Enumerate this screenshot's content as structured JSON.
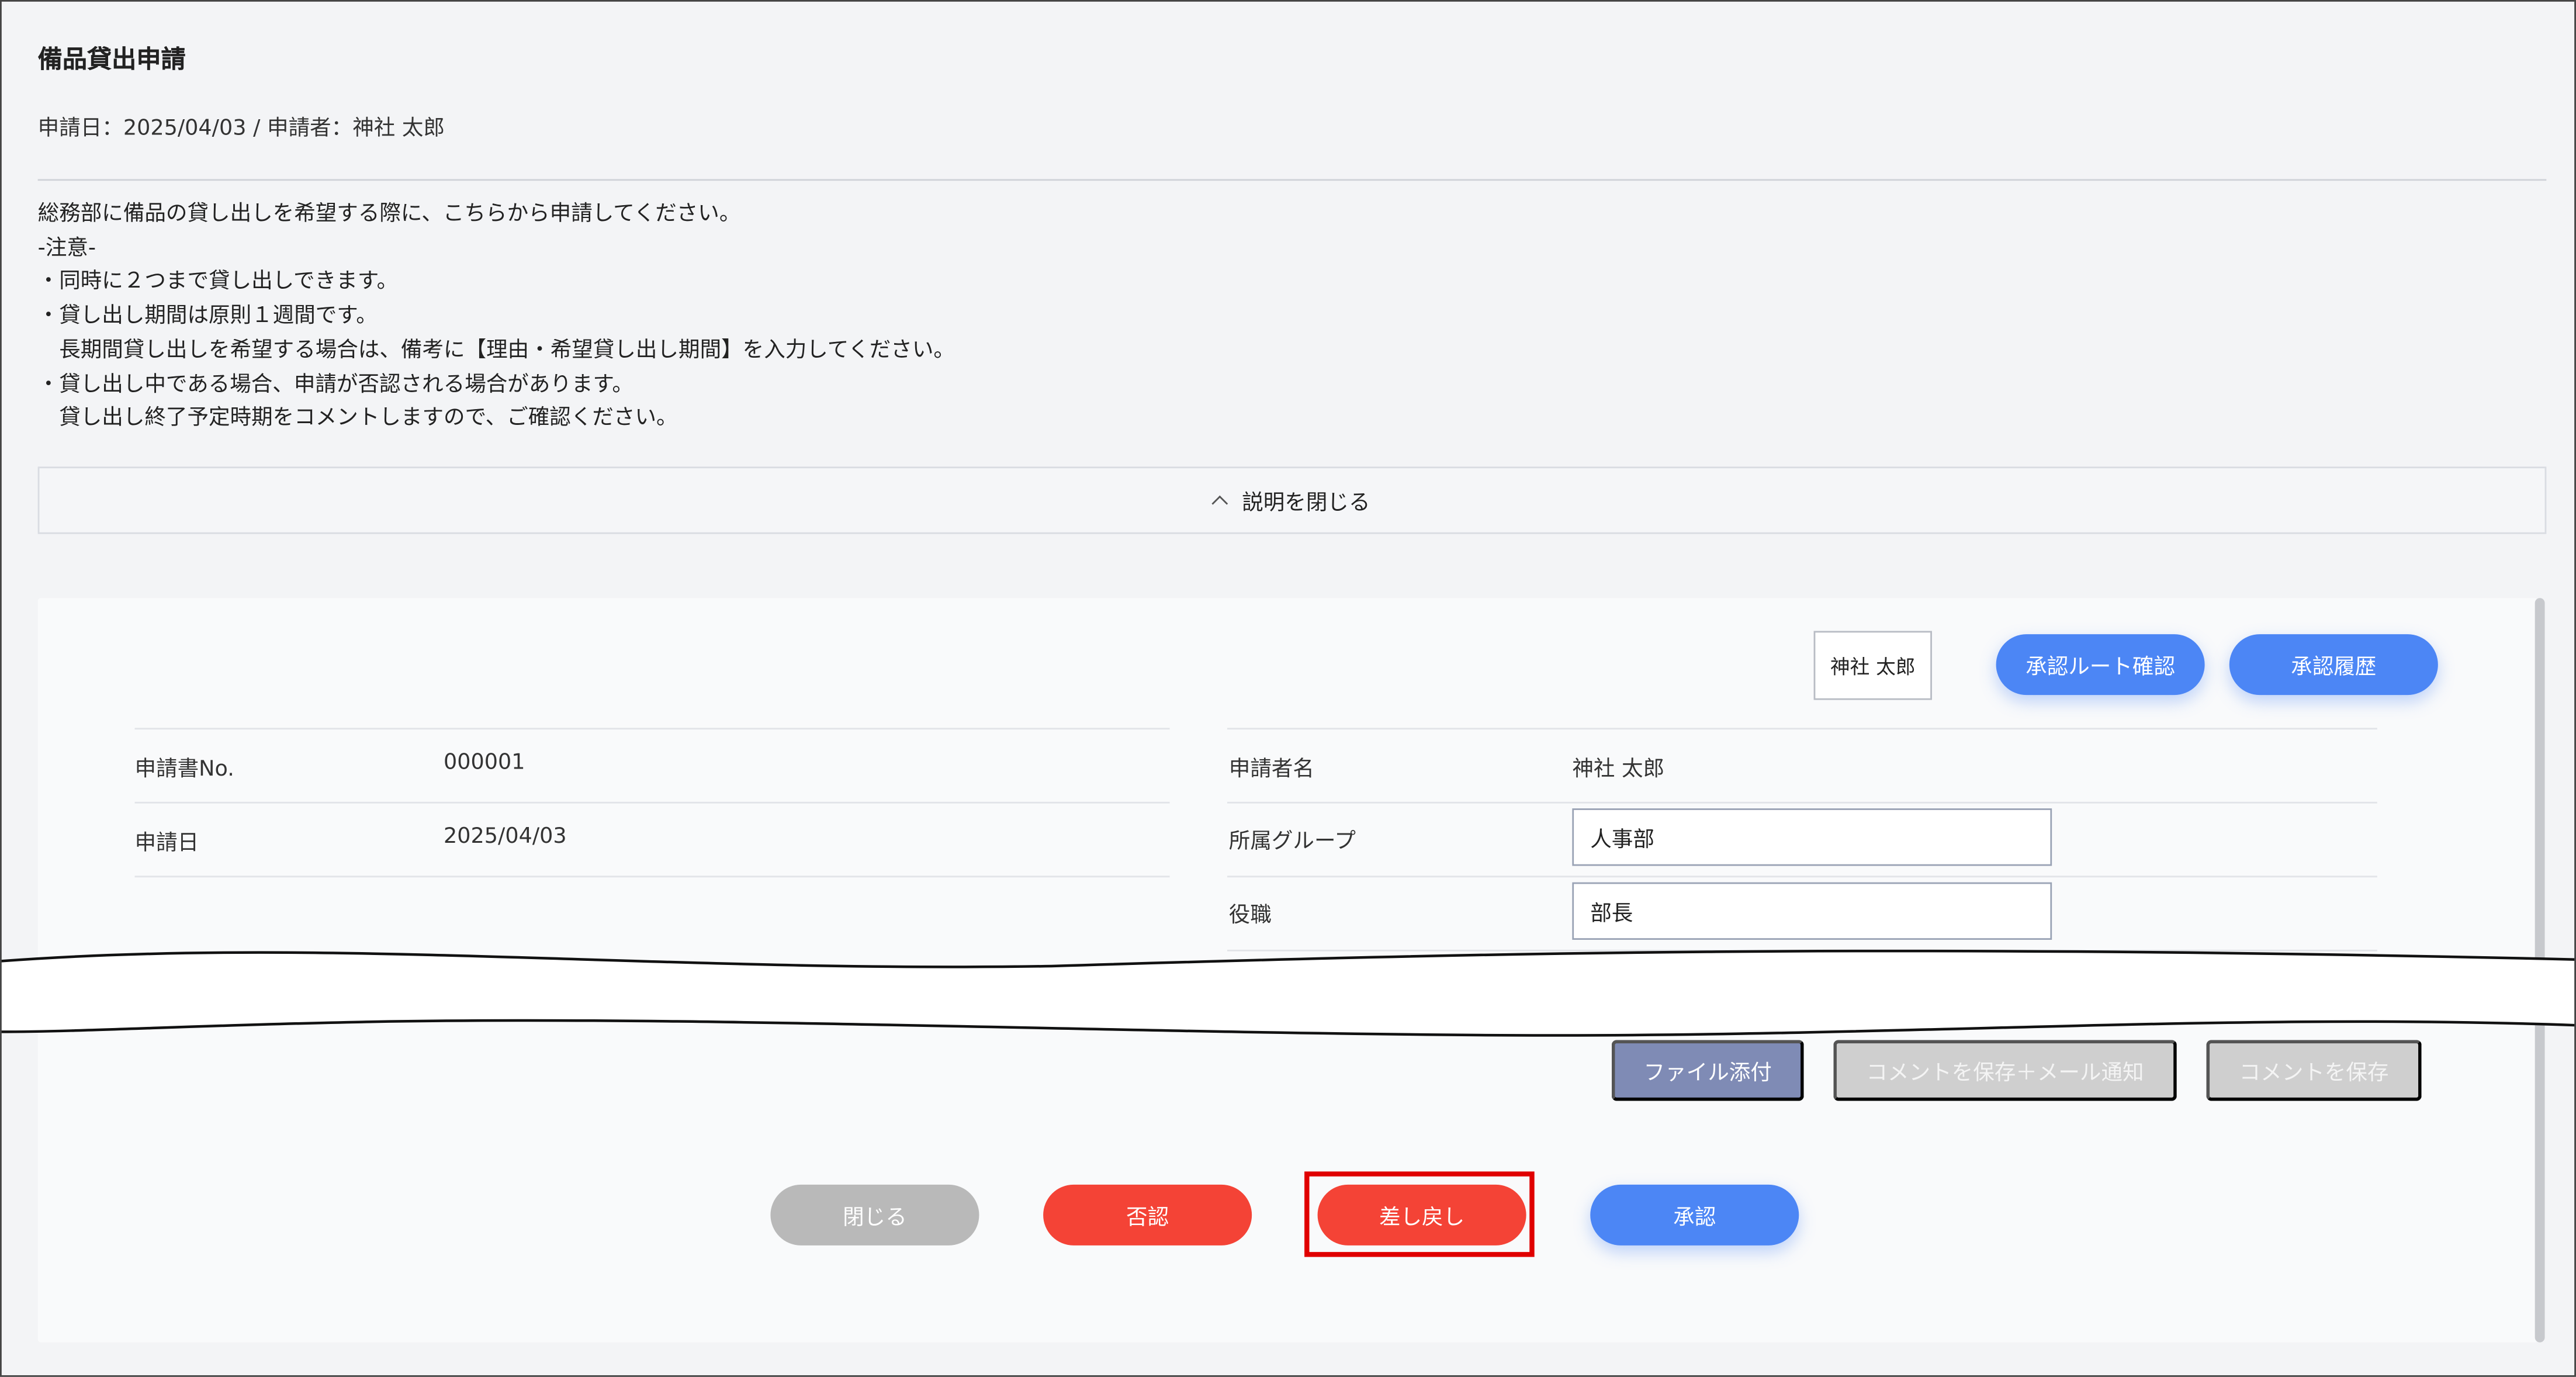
{
  "page": {
    "title": "備品貸出申請",
    "meta": "申請日：2025/04/03 / 申請者：神社 太郎"
  },
  "description": {
    "lines": [
      "総務部に備品の貸し出しを希望する際に、こちらから申請してください。",
      "-注意-",
      "・同時に２つまで貸し出しできます。",
      "・貸し出し期間は原則１週間です。",
      "　長期間貸し出しを希望する場合は、備考に【理由・希望貸し出し期間】を入力してください。",
      "・貸し出し中である場合、申請が否認される場合があります。",
      "　貸し出し終了予定時期をコメントしますので、ご確認ください。"
    ],
    "toggle_label": "説明を閉じる"
  },
  "header_actions": {
    "user_name": "神社 太郎",
    "route_button": "承認ルート確認",
    "history_button": "承認履歴"
  },
  "form": {
    "left": [
      {
        "label": "申請書No.",
        "value": "000001"
      },
      {
        "label": "申請日",
        "value": "2025/04/03"
      }
    ],
    "right": {
      "applicant_label": "申請者名",
      "applicant_value": "神社 太郎",
      "group_label": "所属グループ",
      "group_value": "人事部",
      "position_label": "役職",
      "position_value": "部長"
    }
  },
  "comment_actions": {
    "file_button": "ファイル添付",
    "save_notify_button": "コメントを保存＋メール通知",
    "save_button": "コメントを保存"
  },
  "footer_actions": {
    "close": "閉じる",
    "reject": "否認",
    "return": "差し戻し",
    "approve": "承認"
  },
  "colors": {
    "primary": "#4c86f5",
    "danger": "#f44336",
    "neutral": "#b9b9b9",
    "file": "#7f8bb5",
    "highlight": "#e00000"
  }
}
